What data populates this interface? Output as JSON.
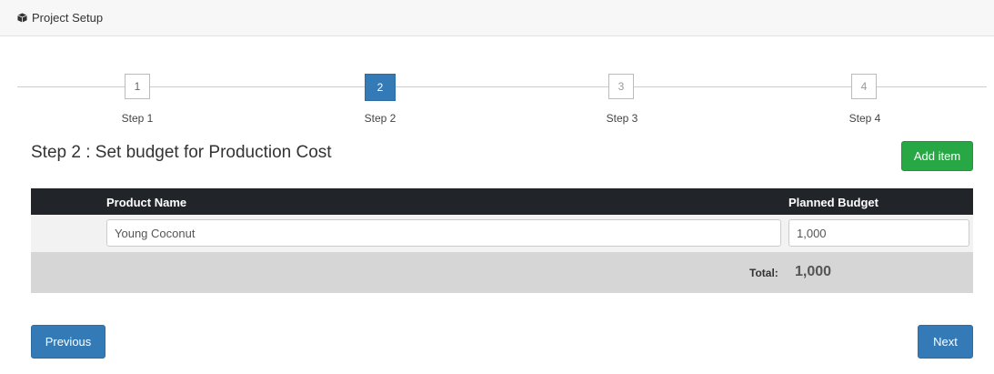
{
  "header": {
    "title": "Project Setup",
    "icon": "cube-icon"
  },
  "stepper": {
    "steps": [
      {
        "number": "1",
        "label": "Step 1"
      },
      {
        "number": "2",
        "label": "Step 2"
      },
      {
        "number": "3",
        "label": "Step 3"
      },
      {
        "number": "4",
        "label": "Step 4"
      }
    ],
    "active_step": 2
  },
  "main": {
    "heading": "Step 2 : Set budget for Production Cost",
    "add_item_label": "Add item",
    "table": {
      "columns": [
        "Product Name",
        "Planned Budget"
      ],
      "rows": [
        {
          "product_name": "Young Coconut",
          "planned_budget": "1,000"
        }
      ],
      "total_label": "Total:",
      "total_value": "1,000"
    }
  },
  "footer": {
    "previous_label": "Previous",
    "next_label": "Next"
  },
  "colors": {
    "primary": "#337ab7",
    "success": "#28a745",
    "table_header": "#212529"
  }
}
